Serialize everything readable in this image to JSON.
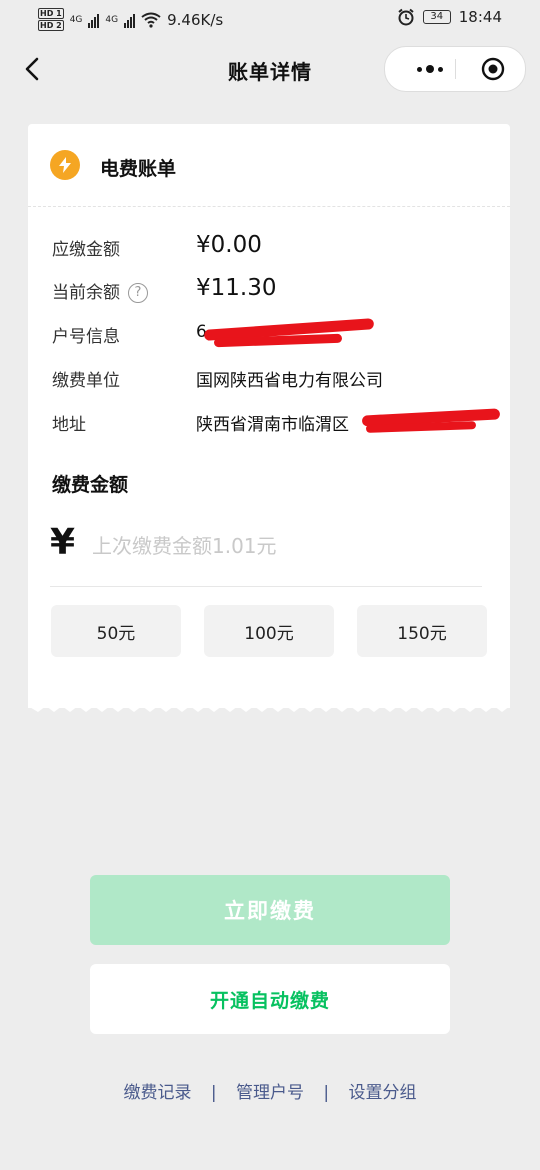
{
  "status_bar": {
    "hd1": "HD 1",
    "hd2": "HD 2",
    "net1": "4G",
    "net2": "4G",
    "speed": "9.46K/s",
    "battery": "34",
    "time": "18:44"
  },
  "nav": {
    "title": "账单详情"
  },
  "bill": {
    "title": "电费账单",
    "rows": [
      {
        "label": "应缴金额",
        "value": "¥0.00"
      },
      {
        "label": "当前余额",
        "value": "¥11.30"
      },
      {
        "label": "户号信息",
        "value": "6"
      },
      {
        "label": "缴费单位",
        "value": "国网陕西省电力有限公司"
      },
      {
        "label": "地址",
        "value": "陕西省渭南市临渭区"
      }
    ],
    "help_icon_text": "?"
  },
  "payment": {
    "title": "缴费金额",
    "currency": "¥",
    "placeholder": "上次缴费金额1.01元",
    "options": [
      "50元",
      "100元",
      "150元"
    ]
  },
  "actions": {
    "pay_now": "立即缴费",
    "auto_pay": "开通自动缴费"
  },
  "links": [
    "缴费记录",
    "管理户号",
    "设置分组"
  ],
  "colors": {
    "bolt": "#F5A623",
    "pay_button": "#B0E8C8",
    "auto_pay_text": "#07C160",
    "link": "#4A5A8C"
  }
}
